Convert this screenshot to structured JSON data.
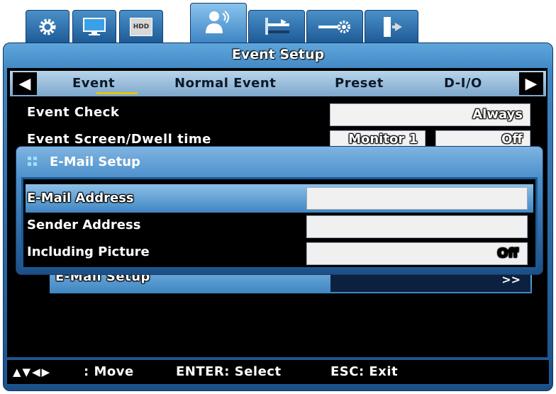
{
  "window": {
    "title": "Event Setup"
  },
  "top_tabs": [
    {
      "icon": "gear-icon"
    },
    {
      "icon": "monitor-icon"
    },
    {
      "icon": "hdd-icon",
      "label": "HDD"
    },
    {
      "icon": "user-signal-icon",
      "active": true
    },
    {
      "icon": "network-icon"
    },
    {
      "icon": "system-settings-icon"
    },
    {
      "icon": "exit-door-icon"
    }
  ],
  "sub_tabs": {
    "left_arrow": "◀",
    "right_arrow": "▶",
    "items": [
      "Event",
      "Normal Event",
      "Preset",
      "D-I/O"
    ],
    "active": "Event"
  },
  "settings": {
    "event_check": {
      "label": "Event Check",
      "value": "Always"
    },
    "event_screen": {
      "label": "Event Screen/Dwell time",
      "monitor": "Monitor 1",
      "dwell": "Off"
    },
    "email_setup": {
      "label": "E-Mail Setup",
      "value": ">>"
    }
  },
  "popup": {
    "title": "E-Mail Setup",
    "rows": [
      {
        "label": "E-Mail Address",
        "value": ""
      },
      {
        "label": "Sender Address",
        "value": ""
      },
      {
        "label": "Including Picture",
        "value": "Off"
      }
    ]
  },
  "help_bar": {
    "arrows": "▲▼◀▶",
    "move": ": Move",
    "select": "ENTER: Select",
    "exit": "ESC: Exit"
  },
  "colors": {
    "accent": "#3f86c2",
    "highlight": "#e8c400",
    "selected_row": "#4a90c8"
  }
}
